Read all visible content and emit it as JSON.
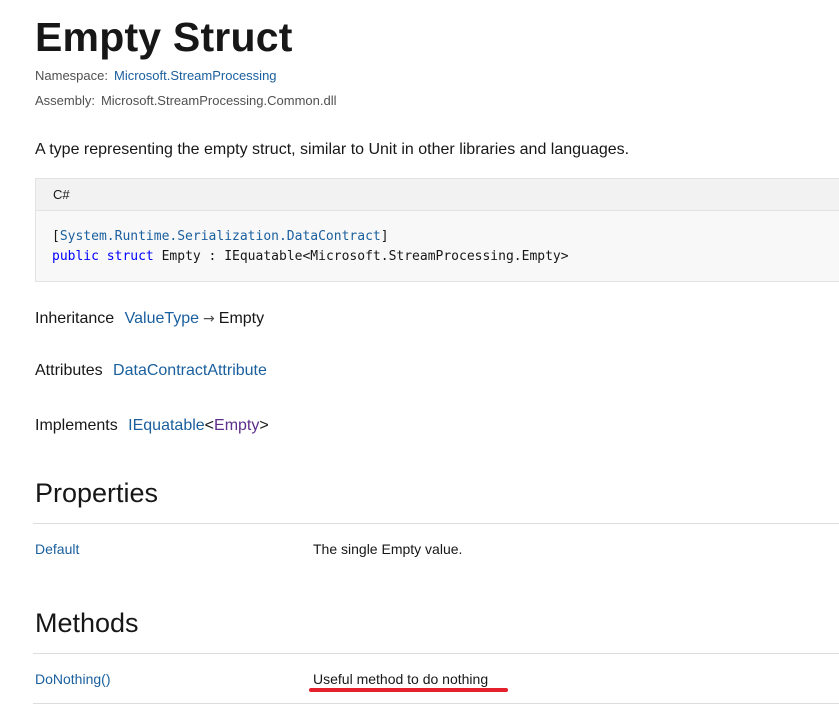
{
  "page": {
    "title": "Empty Struct",
    "namespace_label": "Namespace:",
    "namespace_value": "Microsoft.StreamProcessing",
    "assembly_label": "Assembly:",
    "assembly_value": "Microsoft.StreamProcessing.Common.dll",
    "description": "A type representing the empty struct, similar to Unit in other libraries and languages."
  },
  "code": {
    "language": "C#",
    "line1_open": "[",
    "line1_attr": "System.Runtime.Serialization.DataContract",
    "line1_close": "]",
    "line2_kw1": "public",
    "line2_kw2": "struct",
    "line2_rest": " Empty : IEquatable<Microsoft.StreamProcessing.Empty>"
  },
  "inheritance": {
    "label": "Inheritance",
    "base": "ValueType",
    "arrow": "→",
    "current": "Empty"
  },
  "attributes": {
    "label": "Attributes",
    "value": "DataContractAttribute"
  },
  "implements": {
    "label": "Implements",
    "interface": "IEquatable",
    "lt": "<",
    "type_arg": "Empty",
    "gt": ">"
  },
  "properties": {
    "heading": "Properties",
    "rows": [
      {
        "name": "Default",
        "description": "The single Empty value."
      }
    ]
  },
  "methods": {
    "heading": "Methods",
    "rows": [
      {
        "name": "DoNothing()",
        "description": "Useful method to do nothing"
      }
    ]
  },
  "annotation": {
    "underline_color": "#e3202b"
  }
}
